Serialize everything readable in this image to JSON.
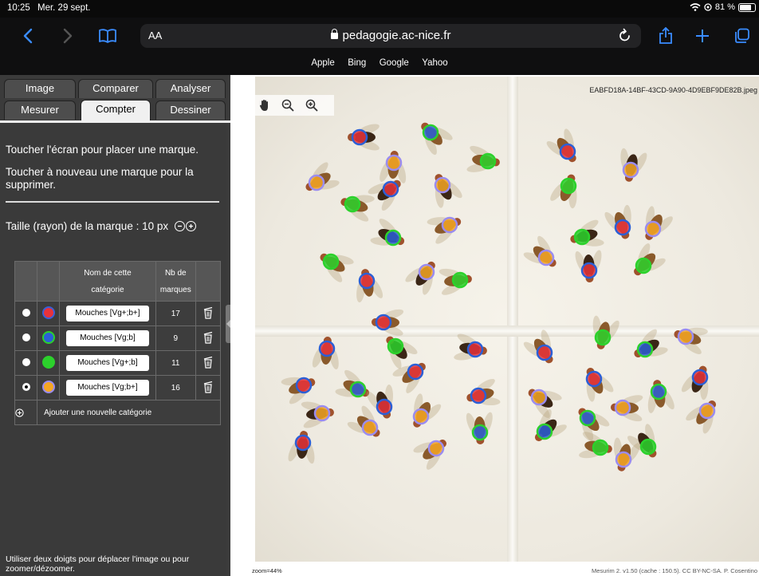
{
  "status": {
    "time": "10:25",
    "date": "Mer. 29 sept.",
    "battery": "81 %"
  },
  "browser": {
    "text_size_label": "AA",
    "url": "pedagogie.ac-nice.fr",
    "favorites": [
      "Apple",
      "Bing",
      "Google",
      "Yahoo"
    ]
  },
  "tabs": {
    "row1": [
      "Image",
      "Comparer",
      "Analyser"
    ],
    "row2": [
      "Mesurer",
      "Compter",
      "Dessiner"
    ],
    "active": "Compter"
  },
  "panel": {
    "instruction_1": "Toucher l'écran pour placer une marque.",
    "instruction_2": "Toucher à nouveau une marque pour la supprimer.",
    "size_label": "Taille (rayon) de la marque : 10 px",
    "table": {
      "col_name": [
        "Nom de cette",
        "catégorie"
      ],
      "col_count": [
        "Nb de",
        "marques"
      ],
      "rows": [
        {
          "name": "Mouches [Vg+;b+]",
          "count": "17",
          "fill": "#e8323a",
          "ring": "#3a5fd9",
          "selected": false
        },
        {
          "name": "Mouches [Vg;b]",
          "count": "9",
          "fill": "#2b5fd6",
          "ring": "#2cd12c",
          "selected": false
        },
        {
          "name": "Mouches [Vg+;b]",
          "count": "11",
          "fill": "#2cd12c",
          "ring": "#2cd12c",
          "selected": false
        },
        {
          "name": "Mouches [Vg;b+]",
          "count": "16",
          "fill": "#f5a623",
          "ring": "#9a8cf0",
          "selected": true
        }
      ],
      "add_label": "Ajouter une nouvelle catégorie"
    },
    "help": "Utiliser deux doigts pour déplacer l'image ou pour zoomer/dézoomer."
  },
  "viewer": {
    "file_name": "EABFD18A-14BF-43CD-9A90-4D9EBF9DE82B.jpeg",
    "zoom": "zoom=44%",
    "credits": "Mesurim 2. v1.50 (cache : 150.5). CC BY-NC-SA. P. Cosentino"
  },
  "colors": {
    "red": "#e8323a",
    "blue": "#2b5fd6",
    "green": "#2cd12c",
    "orange": "#f5a623",
    "lavender": "#9a8cf0"
  }
}
